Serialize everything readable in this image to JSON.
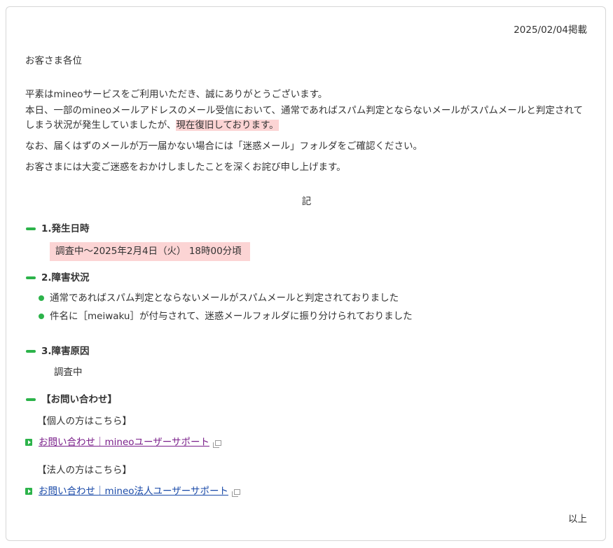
{
  "notice": {
    "date": "2025/02/04掲載",
    "greeting": "お客さま各位",
    "para1": "平素はmineoサービスをご利用いただき、誠にありがとうございます。",
    "para2_line1": "本日、一部のmineoメールアドレスのメール受信において、通常であればスパム判定とならないメールがスパムメールと判定されて",
    "para2_line2_pre": "しまう状況が発生していましたが、",
    "para2_line2_highlight": "現在復旧しております。",
    "para3": "なお、届くはずのメールが万一届かない場合には「迷惑メール」フォルダをご確認ください。",
    "para4": "お客さまには大変ご迷惑をおかけしましたことを深くお詫び申し上げます。",
    "ki": "記",
    "sections": [
      {
        "title": "1.発生日時",
        "body": "調査中～2025年2月4日（火） 18時00分頃"
      },
      {
        "title": "2.障害状況",
        "items": [
          "通常であればスパム判定とならないメールがスパムメールと判定されておりました",
          "件名に［meiwaku］が付与されて、迷惑メールフォルダに振り分けられておりました"
        ]
      },
      {
        "title": "3.障害原因",
        "body": "調査中"
      },
      {
        "title": "【お問い合わせ】"
      }
    ],
    "contact": {
      "personal_label": "【個人の方はこちら】",
      "personal_link": "お問い合わせ｜mineoユーザーサポート",
      "corporate_label": "【法人の方はこちら】",
      "corporate_link": "お問い合わせ｜mineo法人ユーザーサポート"
    },
    "closing": "以上"
  },
  "colors": {
    "accent_green": "#2cb34a",
    "highlight_pink": "#fcd4d4",
    "link_visited": "#7a1f8a",
    "link": "#1a4aa8"
  }
}
